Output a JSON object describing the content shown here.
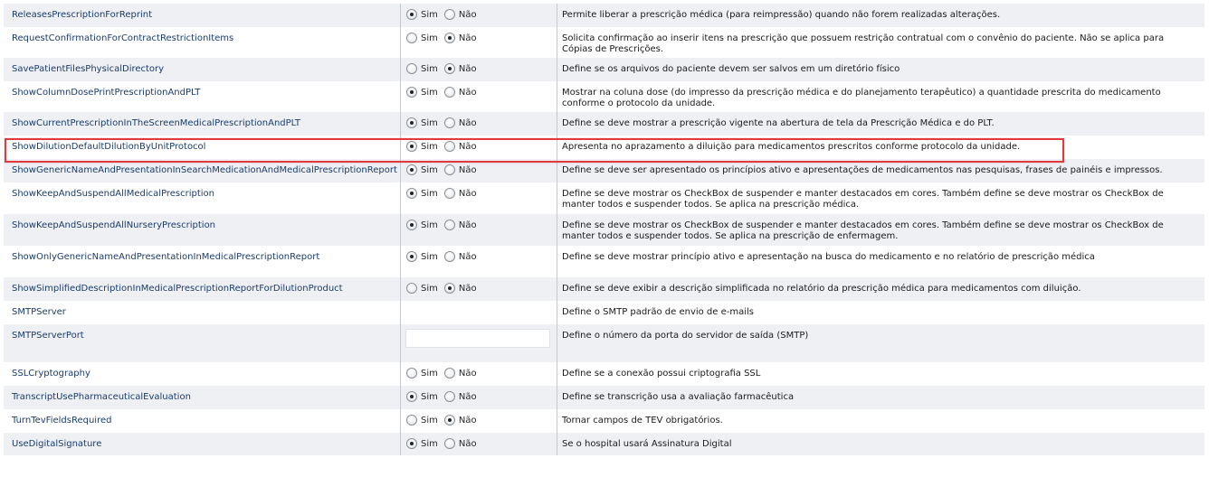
{
  "labels": {
    "sim": "Sim",
    "nao": "Não"
  },
  "colors": {
    "highlight": "#e0393e",
    "row_alt": "#eef0f4",
    "name_text": "#1b3c6b"
  },
  "highlighted_row": "ShowDilutionDefaultDilutionByUnitProtocol",
  "rows": [
    {
      "name": "ReleasesPrescriptionForReprint",
      "type": "radio",
      "value": "sim",
      "description": "Permite liberar a prescrição médica (para reimpressão) quando não forem realizadas alterações."
    },
    {
      "name": "RequestConfirmationForContractRestrictionItems",
      "type": "radio",
      "value": "nao",
      "description": "Solicita confirmação ao inserir itens na prescrição que possuem restrição contratual com o convênio do paciente. Não se aplica para Cópias de Prescrições."
    },
    {
      "name": "SavePatientFilesPhysicalDirectory",
      "type": "radio",
      "value": "nao",
      "description": "Define se os arquivos do paciente devem ser salvos em um diretório físico"
    },
    {
      "name": "ShowColumnDosePrintPrescriptionAndPLT",
      "type": "radio",
      "value": "sim",
      "description": "Mostrar na coluna dose (do impresso da prescrição médica e do planejamento terapêutico) a quantidade prescrita do medicamento conforme o protocolo da unidade."
    },
    {
      "name": "ShowCurrentPrescriptionInTheScreenMedicalPrescriptionAndPLT",
      "type": "radio",
      "value": "sim",
      "description": "Define se deve mostrar a prescrição vigente na abertura de tela da Prescrição Médica e do PLT."
    },
    {
      "name": "ShowDilutionDefaultDilutionByUnitProtocol",
      "type": "radio",
      "value": "sim",
      "description": "Apresenta no aprazamento a diluição para medicamentos prescritos conforme protocolo da unidade."
    },
    {
      "name": "ShowGenericNameAndPresentationInSearchMedicationAndMedicalPrescriptionReport",
      "type": "radio",
      "value": "sim",
      "description": "Define se deve ser apresentado os princípios ativo e apresentações de medicamentos nas pesquisas, frases de painéis e impressos."
    },
    {
      "name": "ShowKeepAndSuspendAllMedicalPrescription",
      "type": "radio",
      "value": "sim",
      "description": "Define se deve mostrar os CheckBox de suspender e manter destacados em cores. Também define se deve mostrar os CheckBox de manter todos e suspender todos. Se aplica na prescrição médica."
    },
    {
      "name": "ShowKeepAndSuspendAllNurseryPrescription",
      "type": "radio",
      "value": "sim",
      "description": "Define se deve mostrar os CheckBox de suspender e manter destacados em cores. Também define se deve mostrar os CheckBox de manter todos e suspender todos. Se aplica na prescrição de enfermagem."
    },
    {
      "name": "ShowOnlyGenericNameAndPresentationInMedicalPrescriptionReport",
      "type": "radio",
      "value": "sim",
      "description": "Define se deve mostrar princípio ativo e apresentação na busca do medicamento e no relatório de prescrição médica"
    },
    {
      "name": "ShowSimplifiedDescriptionInMedicalPrescriptionReportForDilutionProduct",
      "type": "radio",
      "value": "nao",
      "description": "Define se deve exibir a descrição simplificada no relatório da prescrição médica para medicamentos com diluição."
    },
    {
      "name": "SMTPServer",
      "type": "none",
      "value": "",
      "description": "Define o SMTP padrão de envio de e-mails"
    },
    {
      "name": "SMTPServerPort",
      "type": "input",
      "value": "",
      "description": "Define o número da porta do servidor de saída (SMTP)"
    },
    {
      "name": "SSLCryptography",
      "type": "radio",
      "value": "none",
      "description": "Define se a conexão possui criptografia SSL"
    },
    {
      "name": "TranscriptUsePharmaceuticalEvaluation",
      "type": "radio",
      "value": "sim",
      "description": "Define se transcrição usa a avaliação farmacêutica"
    },
    {
      "name": "TurnTevFieldsRequired",
      "type": "radio",
      "value": "nao",
      "description": "Tornar campos de TEV obrigatórios."
    },
    {
      "name": "UseDigitalSignature",
      "type": "radio",
      "value": "sim",
      "description": "Se o hospital usará Assinatura Digital"
    }
  ]
}
